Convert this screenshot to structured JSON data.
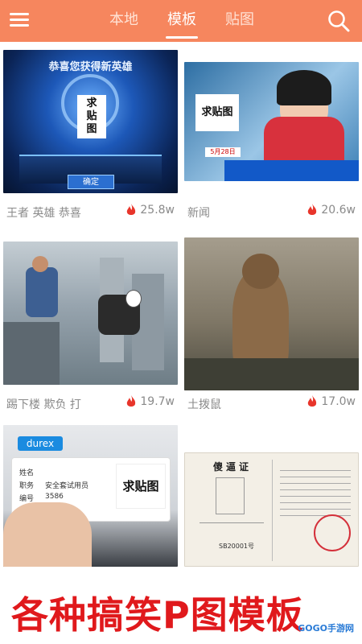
{
  "header": {
    "tabs": [
      {
        "label": "本地",
        "active": false
      },
      {
        "label": "模板",
        "active": true
      },
      {
        "label": "贴图",
        "active": false
      }
    ],
    "icons": {
      "menu": "menu-icon",
      "search": "search-icon"
    },
    "accent": "#f6865e"
  },
  "templates": [
    {
      "caption": "王者 英雄 恭喜",
      "heat": "25.8w",
      "image": {
        "banner": "恭喜您获得新英雄",
        "sticker": "求\n贴\n图",
        "button": "确定"
      }
    },
    {
      "caption": "新闻",
      "heat": "20.6w",
      "image": {
        "sticker": "求贴图",
        "ticker": "5月28日"
      }
    },
    {
      "caption": "踢下楼 欺负 打",
      "heat": "19.7w",
      "image": {}
    },
    {
      "caption": "土拨鼠",
      "heat": "17.0w",
      "image": {}
    },
    {
      "caption": "",
      "heat": "",
      "image": {
        "brand": "durex",
        "fields": [
          "姓名",
          "职务",
          "编号"
        ],
        "role": "安全套试用员",
        "number": "3586",
        "sticker": "求贴图"
      }
    },
    {
      "caption": "",
      "heat": "",
      "image": {
        "title": "傻逼证",
        "number": "SB20001号"
      }
    }
  ],
  "banner": {
    "text": "各种搞笑P图模板",
    "watermark": "GOGO手游网"
  },
  "colors": {
    "hot": "#e8352b",
    "caption": "#8a8a8a",
    "banner": "#e0191c"
  }
}
